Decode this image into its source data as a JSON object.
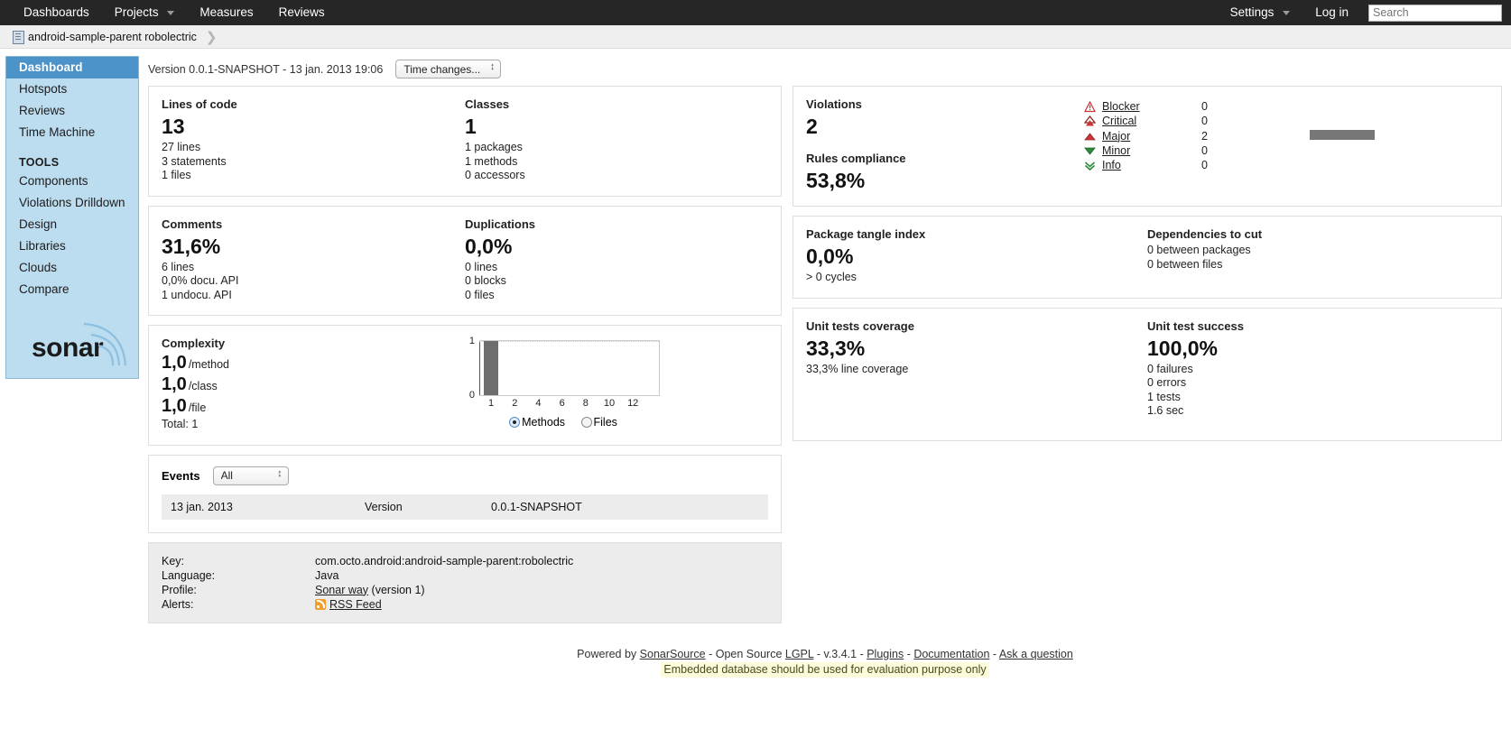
{
  "topnav": {
    "items": [
      {
        "label": "Dashboards",
        "caret": false
      },
      {
        "label": "Projects",
        "caret": true
      },
      {
        "label": "Measures",
        "caret": false
      },
      {
        "label": "Reviews",
        "caret": false
      }
    ],
    "settings_label": "Settings",
    "login_label": "Log in",
    "search_placeholder": "Search",
    "search_value": ""
  },
  "breadcrumb": {
    "project": "android-sample-parent robolectric"
  },
  "sidebar": {
    "items": [
      {
        "label": "Dashboard",
        "active": true
      },
      {
        "label": "Hotspots",
        "active": false
      },
      {
        "label": "Reviews",
        "active": false
      },
      {
        "label": "Time Machine",
        "active": false
      }
    ],
    "tools_header": "TOOLS",
    "tools": [
      {
        "label": "Components"
      },
      {
        "label": "Violations Drilldown"
      },
      {
        "label": "Design"
      },
      {
        "label": "Libraries"
      },
      {
        "label": "Clouds"
      },
      {
        "label": "Compare"
      }
    ],
    "logo_text": "sonar"
  },
  "version_bar": {
    "text": "Version 0.0.1-SNAPSHOT - 13 jan. 2013 19:06",
    "time_changes_label": "Time changes..."
  },
  "widgets": {
    "lines_of_code": {
      "title": "Lines of code",
      "value": "13",
      "details": [
        "27 lines",
        "3 statements",
        "1 files"
      ]
    },
    "classes": {
      "title": "Classes",
      "value": "1",
      "details": [
        "1 packages",
        "1 methods",
        "0 accessors"
      ]
    },
    "comments": {
      "title": "Comments",
      "value": "31,6%",
      "details": [
        "6 lines",
        "0,0% docu. API",
        "1 undocu. API"
      ]
    },
    "duplications": {
      "title": "Duplications",
      "value": "0,0%",
      "details": [
        "0 lines",
        "0 blocks",
        "0 files"
      ]
    },
    "violations": {
      "title": "Violations",
      "value": "2",
      "compliance_title": "Rules compliance",
      "compliance_value": "53,8%",
      "rows": [
        {
          "icon": "blocker-icon",
          "label": "Blocker",
          "count": "0",
          "bar": 0
        },
        {
          "icon": "critical-icon",
          "label": "Critical",
          "count": "0",
          "bar": 0
        },
        {
          "icon": "major-icon",
          "label": "Major",
          "count": "2",
          "bar": 72
        },
        {
          "icon": "minor-icon",
          "label": "Minor",
          "count": "0",
          "bar": 0
        },
        {
          "icon": "info-icon",
          "label": "Info",
          "count": "0",
          "bar": 0
        }
      ]
    },
    "package_tangle": {
      "title": "Package tangle index",
      "value": "0,0%",
      "details": [
        "> 0 cycles"
      ]
    },
    "dependencies_to_cut": {
      "title": "Dependencies to cut",
      "details": [
        "0 between packages",
        "0 between files"
      ]
    },
    "unit_tests_coverage": {
      "title": "Unit tests coverage",
      "value": "33,3%",
      "details": [
        "33,3% line coverage"
      ]
    },
    "unit_test_success": {
      "title": "Unit test success",
      "value": "100,0%",
      "details": [
        "0 failures",
        "0 errors",
        "1 tests",
        "1.6 sec"
      ]
    },
    "complexity": {
      "title": "Complexity",
      "rows": [
        {
          "value": "1,0",
          "unit": "/method"
        },
        {
          "value": "1,0",
          "unit": "/class"
        },
        {
          "value": "1,0",
          "unit": "/file"
        }
      ],
      "total": "Total: 1",
      "radio_methods": "Methods",
      "radio_files": "Files",
      "selected_radio": "Methods"
    }
  },
  "chart_data": {
    "type": "bar",
    "title": "Complexity distribution",
    "categories": [
      "1",
      "2",
      "4",
      "6",
      "8",
      "10",
      "12"
    ],
    "values": [
      1,
      0,
      0,
      0,
      0,
      0,
      0
    ],
    "xlabel": "",
    "ylabel": "",
    "ylim": [
      0,
      1
    ],
    "yticks": [
      "0",
      "1"
    ],
    "grid": true,
    "legend": "none",
    "bar_color": "#6e6e6e"
  },
  "events": {
    "title": "Events",
    "filter_value": "All",
    "rows": [
      {
        "date": "13 jan. 2013",
        "type": "Version",
        "name": "0.0.1-SNAPSHOT"
      }
    ]
  },
  "meta": {
    "rows": [
      {
        "label": "Key:",
        "value": "com.octo.android:android-sample-parent:robolectric",
        "link": "",
        "suffix": ""
      },
      {
        "label": "Language:",
        "value": "Java",
        "link": "",
        "suffix": ""
      },
      {
        "label": "Profile:",
        "value": "",
        "link": "Sonar way",
        "suffix": " (version 1)"
      },
      {
        "label": "Alerts:",
        "value": "",
        "link": "RSS Feed",
        "suffix": ""
      }
    ]
  },
  "footer": {
    "powered_by": "Powered by ",
    "sonarsource": "SonarSource",
    "open_source": " - Open Source ",
    "lgpl": "LGPL",
    "version": " - v.3.4.1 - ",
    "plugins": "Plugins",
    "sep1": " - ",
    "documentation": "Documentation",
    "sep2": " - ",
    "ask": "Ask a question",
    "warning": "Embedded database should be used for evaluation purpose only"
  },
  "colors": {
    "nav_bg": "#262626",
    "sidebar_bg": "#bcdcef",
    "sidebar_active": "#4b93c8",
    "severity_red": "#cc3333",
    "severity_green": "#2e8b3d",
    "bar_gray": "#777777"
  }
}
